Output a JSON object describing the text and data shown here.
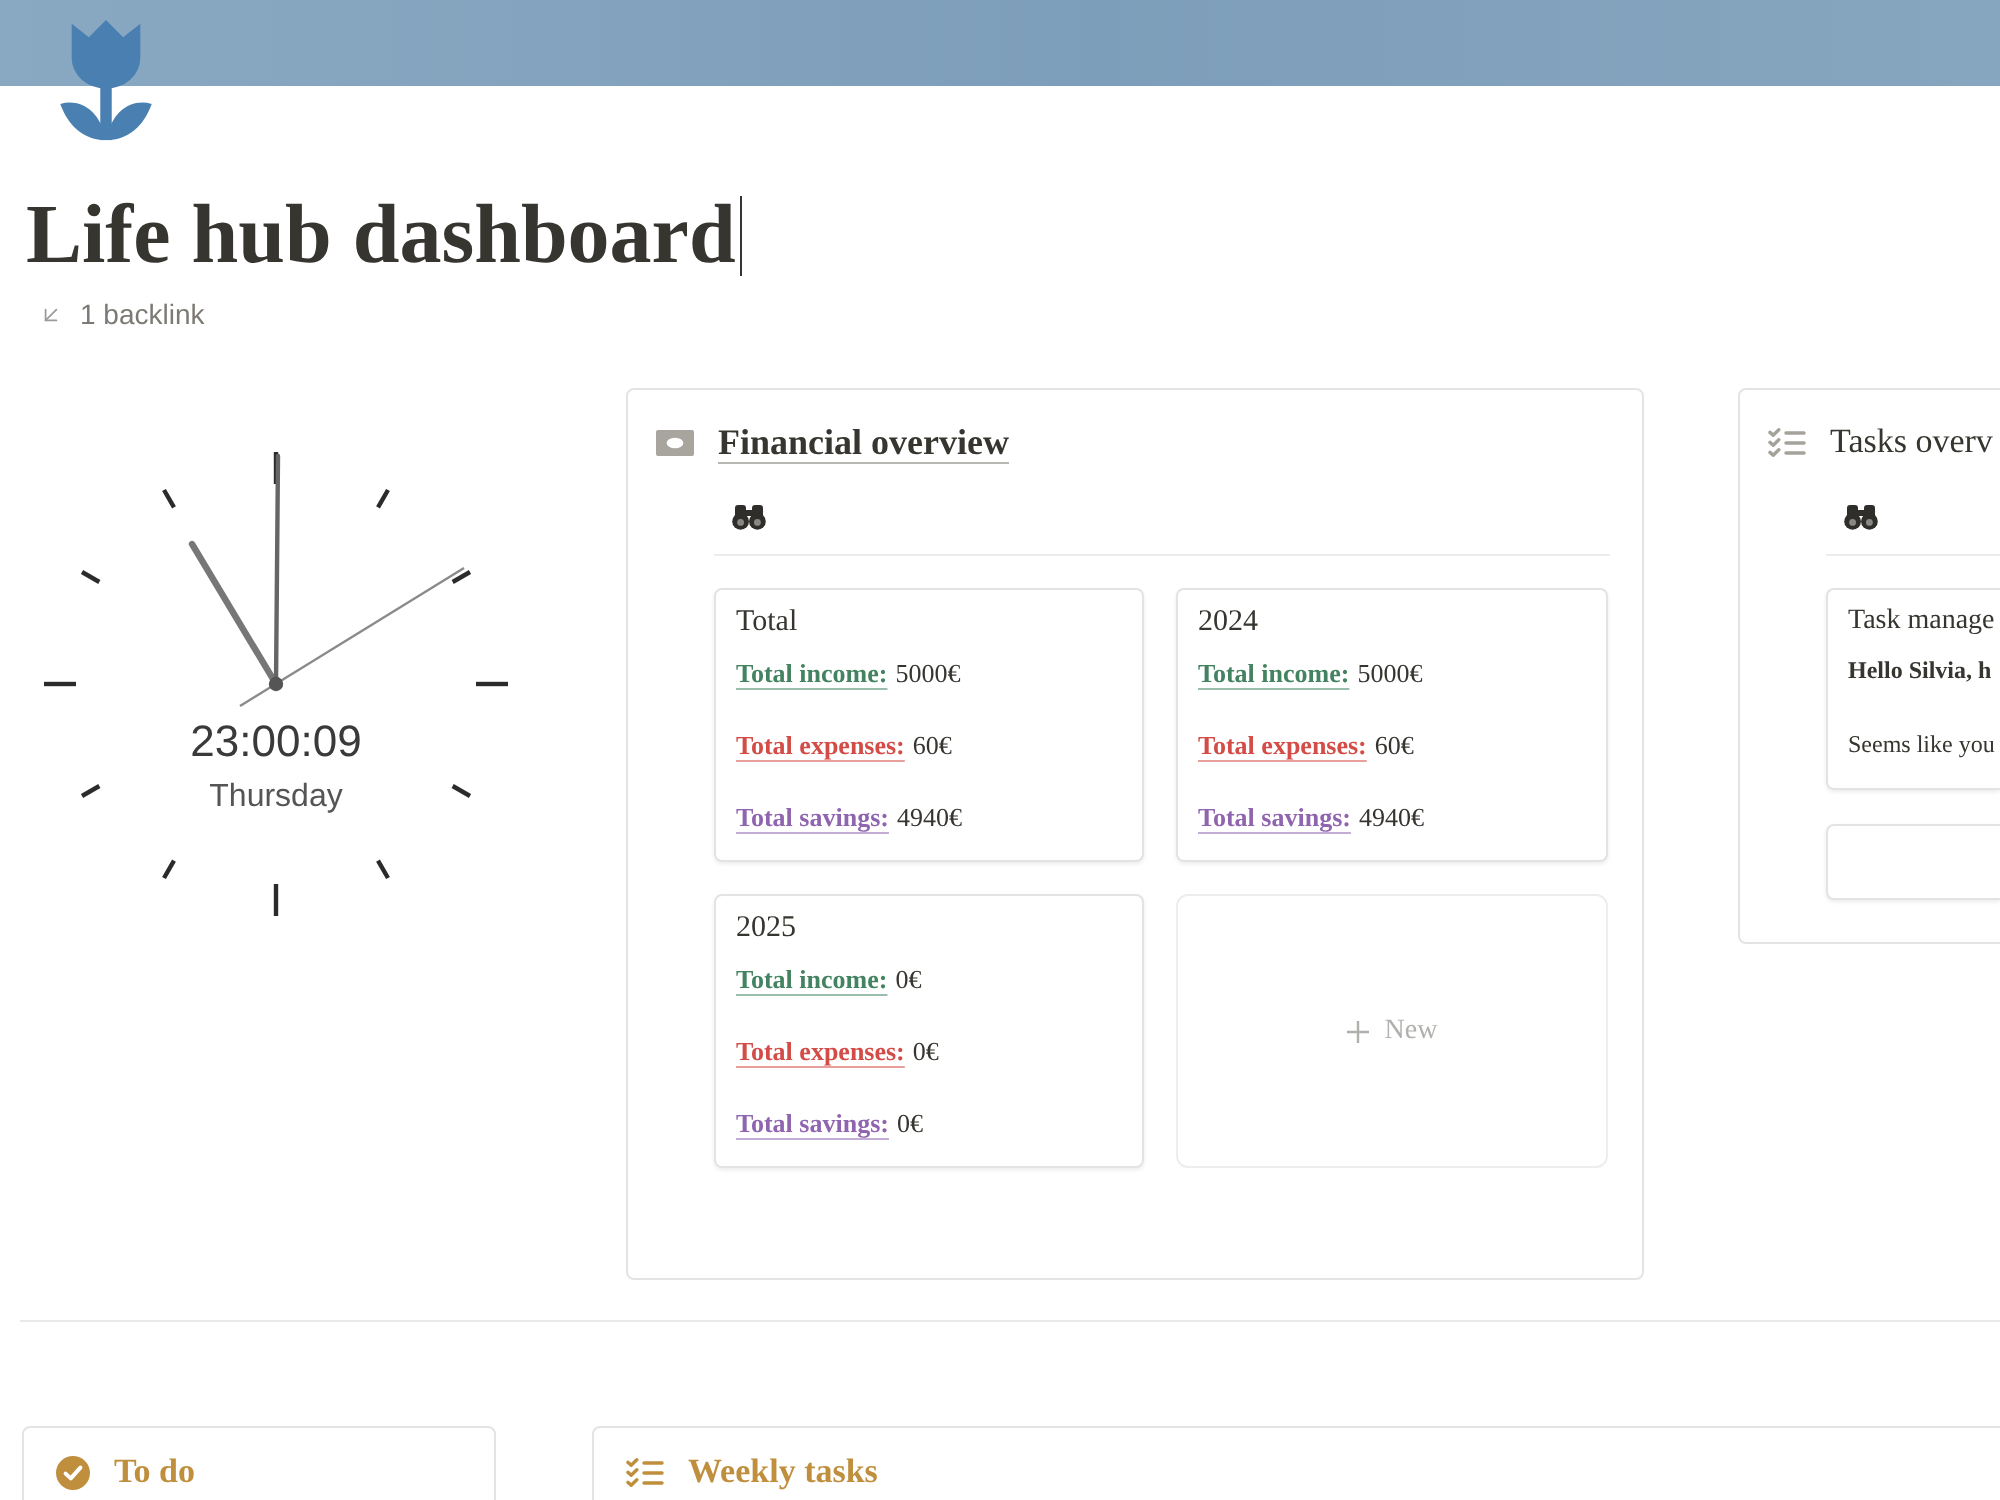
{
  "page": {
    "title": "Life hub dashboard",
    "backlinks": "1 backlink"
  },
  "clock": {
    "time": "23:00:09",
    "day": "Thursday"
  },
  "financial_overview": {
    "title": "Financial overview",
    "cards": [
      {
        "title": "Total",
        "lines": [
          {
            "label": "Total income:",
            "value": "5000€",
            "color": "#448361"
          },
          {
            "label": "Total expenses:",
            "value": "60€",
            "color": "#d44c47"
          },
          {
            "label": "Total savings:",
            "value": "4940€",
            "color": "#9065b0"
          }
        ]
      },
      {
        "title": "2024",
        "lines": [
          {
            "label": "Total income:",
            "value": "5000€",
            "color": "#448361"
          },
          {
            "label": "Total expenses:",
            "value": "60€",
            "color": "#d44c47"
          },
          {
            "label": "Total savings:",
            "value": "4940€",
            "color": "#9065b0"
          }
        ]
      },
      {
        "title": "2025",
        "lines": [
          {
            "label": "Total income:",
            "value": "0€",
            "color": "#448361"
          },
          {
            "label": "Total expenses:",
            "value": "0€",
            "color": "#d44c47"
          },
          {
            "label": "Total savings:",
            "value": "0€",
            "color": "#9065b0"
          }
        ]
      }
    ],
    "new_label": "New"
  },
  "tasks_overview": {
    "title": "Tasks overv",
    "cards": [
      {
        "kind": "note",
        "title": "Task manage",
        "greeting": "Hello Silvia, h",
        "message": "Seems like you"
      },
      {
        "kind": "blank"
      }
    ]
  },
  "bottom_panels": [
    {
      "kind": "todo",
      "title": "To do"
    },
    {
      "kind": "weekly",
      "title": "Weekly tasks"
    }
  ]
}
